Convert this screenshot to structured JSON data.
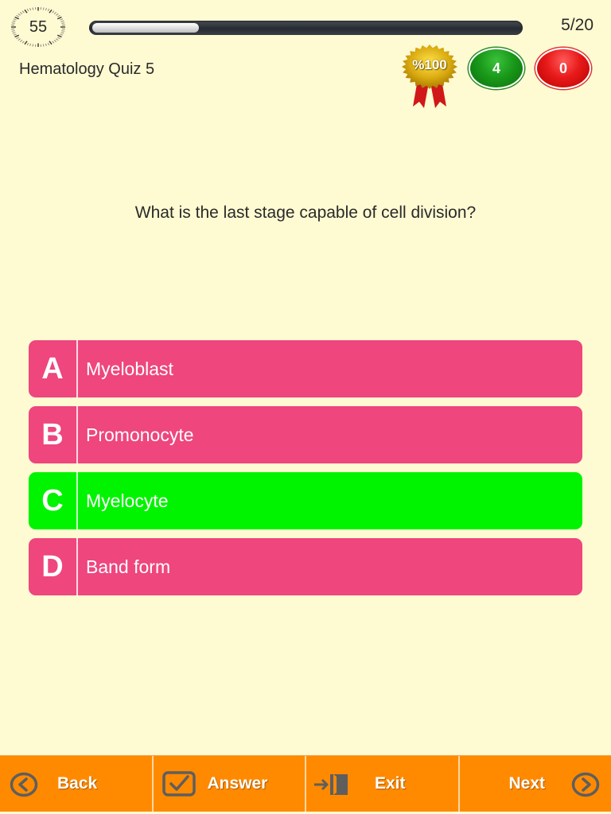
{
  "header": {
    "timer_value": "55",
    "progress_fraction": 0.25,
    "counter": "5/20",
    "quiz_title": "Hematology Quiz 5"
  },
  "score": {
    "award_label": "%100",
    "correct_count": "4",
    "wrong_count": "0",
    "colors": {
      "correct": "#1a9a1a",
      "wrong": "#e81a1a",
      "award": "#d4a800"
    }
  },
  "question": {
    "text": "What is the last stage capable of cell division?"
  },
  "answers": [
    {
      "letter": "A",
      "text": "Myeloblast",
      "state": "default"
    },
    {
      "letter": "B",
      "text": "Promonocyte",
      "state": "default"
    },
    {
      "letter": "C",
      "text": "Myelocyte",
      "state": "correct"
    },
    {
      "letter": "D",
      "text": "Band form",
      "state": "default"
    }
  ],
  "answer_colors": {
    "default": "#ee467d",
    "correct": "#00f400"
  },
  "toolbar": {
    "back": {
      "label": "Back",
      "icon": "chevron-left-circle-icon"
    },
    "answer": {
      "label": "Answer",
      "icon": "checkbox-icon"
    },
    "exit": {
      "label": "Exit",
      "icon": "exit-door-icon"
    },
    "next": {
      "label": "Next",
      "icon": "chevron-right-circle-icon"
    },
    "background": "#ff8a00"
  }
}
